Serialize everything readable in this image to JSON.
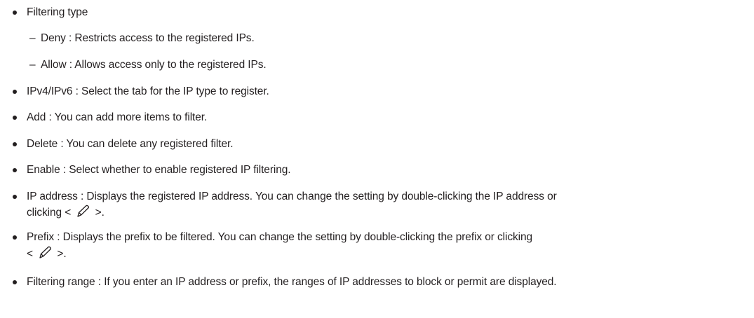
{
  "items": {
    "filtering_type": "Filtering type",
    "deny": "Deny : Restricts access to the registered IPs.",
    "allow": "Allow : Allows access only to the registered IPs.",
    "ipv4_ipv6": "IPv4/IPv6 : Select the tab for the IP type to register.",
    "add": "Add : You can add more items to filter.",
    "delete": "Delete : You can delete any registered filter.",
    "enable": "Enable : Select whether to enable registered IP filtering.",
    "ip_address_line1": "IP address : Displays the registered IP address. You can change the setting by double-clicking the IP address or",
    "ip_address_line2_pre": "clicking <",
    "ip_address_line2_post": ">.",
    "prefix_line1": "Prefix : Displays the prefix to be filtered. You can change the setting by double-clicking the prefix or clicking",
    "prefix_line2_pre": "<",
    "prefix_line2_post": ">.",
    "filtering_range": "Filtering range : If you enter an IP address or prefix, the ranges of IP addresses to block or permit are displayed."
  },
  "icons": {
    "edit_icon": "pencil-icon"
  },
  "dash_char": "–"
}
